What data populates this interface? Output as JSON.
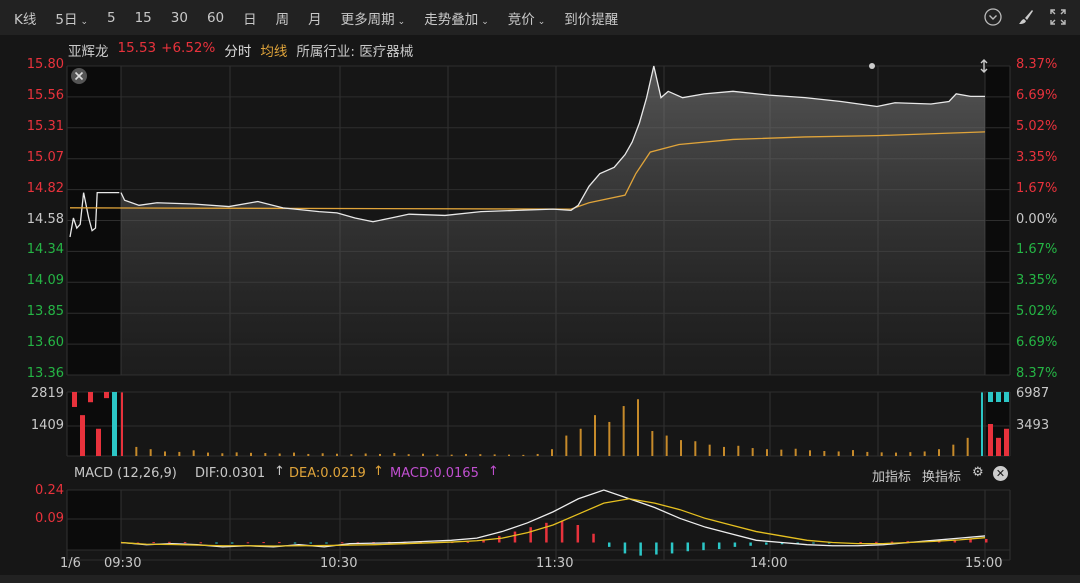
{
  "toolbar": {
    "items": [
      {
        "label": "K线"
      },
      {
        "label": "5日",
        "dropdown": true
      },
      {
        "label": "5"
      },
      {
        "label": "15"
      },
      {
        "label": "30"
      },
      {
        "label": "60"
      },
      {
        "label": "日"
      },
      {
        "label": "周"
      },
      {
        "label": "月"
      },
      {
        "label": "更多周期",
        "dropdown": true
      },
      {
        "label": "走势叠加",
        "dropdown": true
      },
      {
        "label": "竞价",
        "dropdown": true
      },
      {
        "label": "到价提醒"
      }
    ],
    "icons": [
      "chevron-circle-icon",
      "brush-icon",
      "fullscreen-icon"
    ]
  },
  "info": {
    "name": "亚辉龙",
    "price": "15.53",
    "change": "+6.52%",
    "mode": "分时",
    "avg": "均线",
    "industry": "所属行业: 医疗器械"
  },
  "price_axis": {
    "left": [
      "15.80",
      "15.56",
      "15.31",
      "15.07",
      "14.82",
      "14.58",
      "14.34",
      "14.09",
      "13.85",
      "13.60",
      "13.36"
    ],
    "right": [
      "8.37%",
      "6.69%",
      "5.02%",
      "3.35%",
      "1.67%",
      "0.00%",
      "1.67%",
      "3.35%",
      "5.02%",
      "6.69%",
      "8.37%"
    ],
    "max": 15.8,
    "min": 13.36
  },
  "volume_axis": {
    "left": [
      "2819",
      "1409"
    ],
    "right": [
      "6987",
      "3493"
    ]
  },
  "macd": {
    "title": "MACD (12,26,9)",
    "dif": "DIF:0.0301",
    "dea": "DEA:0.0219",
    "macd": "MACD:0.0165",
    "arrow": "↑",
    "add": "加指标",
    "switch": "换指标",
    "axis": [
      "0.24",
      "0.09"
    ]
  },
  "time_axis": [
    "1/6",
    "09:30",
    "10:30",
    "11:30",
    "14:00",
    "15:00"
  ],
  "colors": {
    "up": "#e8323c",
    "down": "#25b545",
    "avg": "#e0a43a",
    "line": "#e8e8e8",
    "cyan": "#2cc6c6"
  },
  "chart_data": {
    "type": "line",
    "pre_price": [
      [
        -30,
        14.45
      ],
      [
        -28,
        14.6
      ],
      [
        -26,
        14.52
      ],
      [
        -24,
        14.55
      ],
      [
        -22,
        14.8
      ],
      [
        -19,
        14.6
      ],
      [
        -17,
        14.5
      ],
      [
        -15,
        14.52
      ],
      [
        -14,
        14.8
      ],
      [
        -1,
        14.8
      ]
    ],
    "price": [
      [
        0,
        14.8
      ],
      [
        1,
        14.74
      ],
      [
        5,
        14.7
      ],
      [
        10,
        14.72
      ],
      [
        20,
        14.71
      ],
      [
        30,
        14.69
      ],
      [
        38,
        14.73
      ],
      [
        45,
        14.68
      ],
      [
        55,
        14.65
      ],
      [
        60,
        14.64
      ],
      [
        65,
        14.6
      ],
      [
        70,
        14.57
      ],
      [
        75,
        14.6
      ],
      [
        80,
        14.63
      ],
      [
        90,
        14.62
      ],
      [
        100,
        14.65
      ],
      [
        110,
        14.66
      ],
      [
        120,
        14.67
      ],
      [
        125,
        14.66
      ],
      [
        127,
        14.7
      ],
      [
        130,
        14.85
      ],
      [
        133,
        14.95
      ],
      [
        137,
        15.0
      ],
      [
        140,
        15.1
      ],
      [
        142,
        15.2
      ],
      [
        144,
        15.35
      ],
      [
        146,
        15.55
      ],
      [
        148,
        15.8
      ],
      [
        150,
        15.55
      ],
      [
        152,
        15.6
      ],
      [
        156,
        15.55
      ],
      [
        162,
        15.58
      ],
      [
        170,
        15.6
      ],
      [
        180,
        15.57
      ],
      [
        190,
        15.55
      ],
      [
        200,
        15.52
      ],
      [
        210,
        15.48
      ],
      [
        215,
        15.51
      ],
      [
        225,
        15.5
      ],
      [
        230,
        15.52
      ],
      [
        232,
        15.58
      ],
      [
        236,
        15.56
      ],
      [
        240,
        15.56
      ]
    ],
    "avg": [
      [
        -30,
        14.68
      ],
      [
        125,
        14.67
      ],
      [
        130,
        14.72
      ],
      [
        140,
        14.78
      ],
      [
        143,
        14.95
      ],
      [
        147,
        15.12
      ],
      [
        155,
        15.18
      ],
      [
        170,
        15.22
      ],
      [
        190,
        15.24
      ],
      [
        210,
        15.25
      ],
      [
        240,
        15.28
      ]
    ],
    "volume": [
      2800,
      400,
      300,
      200,
      180,
      250,
      150,
      120,
      160,
      140,
      130,
      110,
      150,
      90,
      120,
      100,
      80,
      110,
      90,
      130,
      80,
      100,
      70,
      60,
      90,
      80,
      70,
      60,
      50,
      90,
      300,
      900,
      1200,
      1800,
      1500,
      2200,
      2500,
      1100,
      900,
      700,
      650,
      500,
      400,
      450,
      350,
      300,
      280,
      320,
      250,
      220,
      200,
      260,
      180,
      160,
      150,
      170,
      200,
      300,
      500,
      800,
      2800
    ],
    "macd_hist": [
      0,
      0,
      0.002,
      0.003,
      0.002,
      0.001,
      -0.001,
      -0.002,
      0.001,
      0.002,
      0.002,
      -0.001,
      -0.002,
      -0.001,
      0.001,
      0.001,
      0.002,
      0.003,
      0.004,
      0.004,
      0.003,
      0.002,
      0.003,
      0.01,
      0.03,
      0.05,
      0.07,
      0.09,
      0.1,
      0.08,
      0.04,
      -0.02,
      -0.05,
      -0.06,
      -0.055,
      -0.05,
      -0.04,
      -0.035,
      -0.03,
      -0.02,
      -0.015,
      -0.01,
      -0.008,
      -0.006,
      -0.004,
      -0.003,
      0,
      0.002,
      0.003,
      0.004,
      0.006,
      0.008,
      0.01,
      0.012,
      0.015,
      0.016
    ],
    "dif": [
      0,
      -0.01,
      -0.005,
      -0.01,
      -0.02,
      -0.015,
      -0.02,
      -0.01,
      -0.02,
      -0.005,
      -0.003,
      0,
      0.005,
      0.01,
      0.02,
      0.05,
      0.09,
      0.14,
      0.2,
      0.24,
      0.2,
      0.16,
      0.11,
      0.07,
      0.04,
      0.01,
      0,
      -0.01,
      -0.015,
      -0.015,
      -0.01,
      0,
      0.01,
      0.02,
      0.03
    ],
    "dea": [
      0,
      -0.008,
      -0.009,
      -0.012,
      -0.015,
      -0.015,
      -0.016,
      -0.015,
      -0.014,
      -0.012,
      -0.01,
      -0.006,
      -0.002,
      0.002,
      0.008,
      0.02,
      0.045,
      0.08,
      0.13,
      0.18,
      0.2,
      0.18,
      0.15,
      0.11,
      0.08,
      0.05,
      0.03,
      0.01,
      0,
      -0.005,
      -0.005,
      0,
      0.005,
      0.012,
      0.022
    ],
    "macd_range": [
      -0.08,
      0.24
    ]
  }
}
